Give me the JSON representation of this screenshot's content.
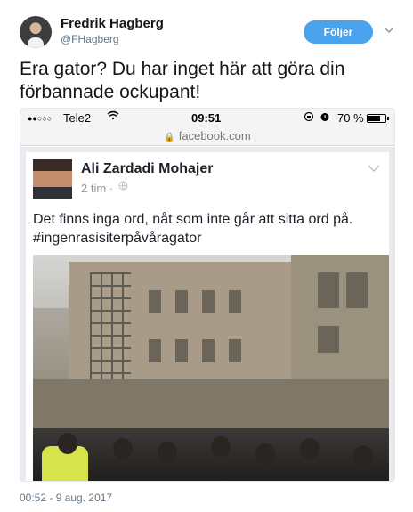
{
  "author": {
    "name": "Fredrik Hagberg",
    "handle": "@FHagberg"
  },
  "follow_button": {
    "label": "Följer"
  },
  "tweet": {
    "text": "Era gator? Du har inget här att göra din förbannade ockupant!",
    "timestamp": "00:52 - 9 aug. 2017"
  },
  "phone": {
    "carrier": "Tele2",
    "time": "09:51",
    "battery_text": "70 %",
    "battery_level": 0.7,
    "url": "facebook.com"
  },
  "fb_post": {
    "author": "Ali Zardadi Mohajer",
    "time": "2 tim",
    "separator": "·",
    "text_line1": "Det finns inga ord, nåt som inte går att sitta ord på.",
    "text_line2": "#ingenrasisiterpåvåragator"
  },
  "icons": {
    "signal": "signal-dots-icon",
    "wifi": "wifi-icon",
    "rotation_lock": "rotation-lock-icon",
    "alarm": "alarm-icon",
    "battery": "battery-icon",
    "lock": "lock-icon",
    "globe": "globe-icon",
    "chevron": "chevron-down-icon"
  },
  "colors": {
    "follow_button": "#4aa1ec",
    "handle": "#657786",
    "text": "#14171a"
  }
}
